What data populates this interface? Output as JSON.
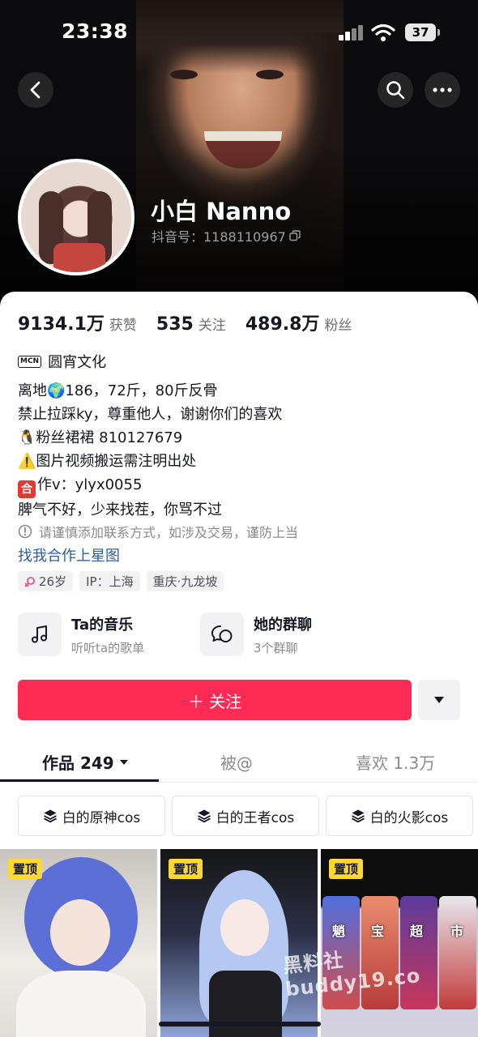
{
  "status_bar": {
    "time": "23:38",
    "battery": "37"
  },
  "profile": {
    "nickname": "小白 Nanno",
    "account_id": "抖音号：1188110967"
  },
  "stats": [
    {
      "value": "9134.1万",
      "label": "获赞"
    },
    {
      "value": "535",
      "label": "关注"
    },
    {
      "value": "489.8万",
      "label": "粉丝"
    }
  ],
  "mcn": {
    "badge": "MCN",
    "name": "圆宵文化"
  },
  "bio": {
    "line1": "离地🌍186，72斤，80斤反骨",
    "line2": "禁止拉踩ky，尊重他人，谢谢你们的喜欢",
    "line3": "🐧粉丝裙裙 810127679",
    "line4": "⚠️图片视频搬运需注明出处",
    "line5_icon": "合",
    "line5_text": "作v：ylyx0055",
    "line6": "脾气不好，少来找茬，你骂不过"
  },
  "contact_warning": "请谨慎添加联系方式，如涉及交易，谨防上当",
  "star_link": "找我合作上星图",
  "tags": {
    "age": "26岁",
    "ip": "IP：上海",
    "location": "重庆·九龙坡"
  },
  "cards": {
    "music": {
      "title": "Ta的音乐",
      "subtitle": "听听ta的歌单"
    },
    "group": {
      "title": "她的群聊",
      "subtitle": "3个群聊"
    }
  },
  "follow_button": "＋ 关注",
  "tabs": {
    "works": "作品 249",
    "mentioned": "被@",
    "likes": "喜欢 1.3万"
  },
  "collections": [
    "白的原神cos",
    "白的王者cos",
    "白的火影cos"
  ],
  "pin_label": "置顶",
  "thumb3_labels": [
    "魈",
    "宝",
    "超",
    "市"
  ],
  "watermark": "黑料社 buddy19.co"
}
